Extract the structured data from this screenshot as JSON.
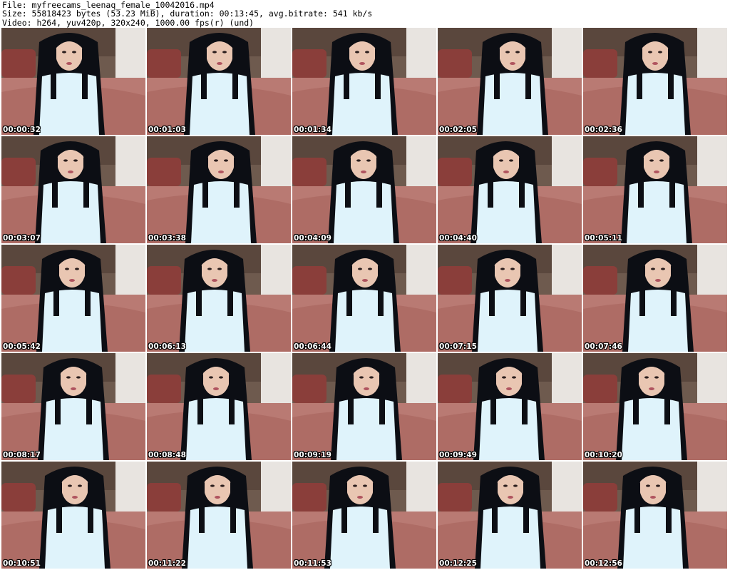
{
  "header": {
    "file_line": "File: myfreecams_leenaq_female_10042016.mp4",
    "size_line": "Size: 55818423 bytes (53.23 MiB), duration: 00:13:45, avg.bitrate: 541 kb/s",
    "video_line": "Video: h264, yuv420p, 320x240, 1000.00 fps(r) (und)"
  },
  "thumbnails": [
    {
      "timestamp": "00:00:32"
    },
    {
      "timestamp": "00:01:03"
    },
    {
      "timestamp": "00:01:34"
    },
    {
      "timestamp": "00:02:05"
    },
    {
      "timestamp": "00:02:36"
    },
    {
      "timestamp": "00:03:07"
    },
    {
      "timestamp": "00:03:38"
    },
    {
      "timestamp": "00:04:09"
    },
    {
      "timestamp": "00:04:40"
    },
    {
      "timestamp": "00:05:11"
    },
    {
      "timestamp": "00:05:42"
    },
    {
      "timestamp": "00:06:13"
    },
    {
      "timestamp": "00:06:44"
    },
    {
      "timestamp": "00:07:15"
    },
    {
      "timestamp": "00:07:46"
    },
    {
      "timestamp": "00:08:17"
    },
    {
      "timestamp": "00:08:48"
    },
    {
      "timestamp": "00:09:19"
    },
    {
      "timestamp": "00:09:49"
    },
    {
      "timestamp": "00:10:20"
    },
    {
      "timestamp": "00:10:51"
    },
    {
      "timestamp": "00:11:22"
    },
    {
      "timestamp": "00:11:53"
    },
    {
      "timestamp": "00:12:25"
    },
    {
      "timestamp": "00:12:56"
    }
  ],
  "colors": {
    "wall": "#6e5a4e",
    "sofa": "#8a3e3a",
    "bed": "#b97a73",
    "door": "#e8e4e0",
    "dress": "#dff3fb",
    "hair": "#0c0e14",
    "skin": "#e9c6b2"
  }
}
